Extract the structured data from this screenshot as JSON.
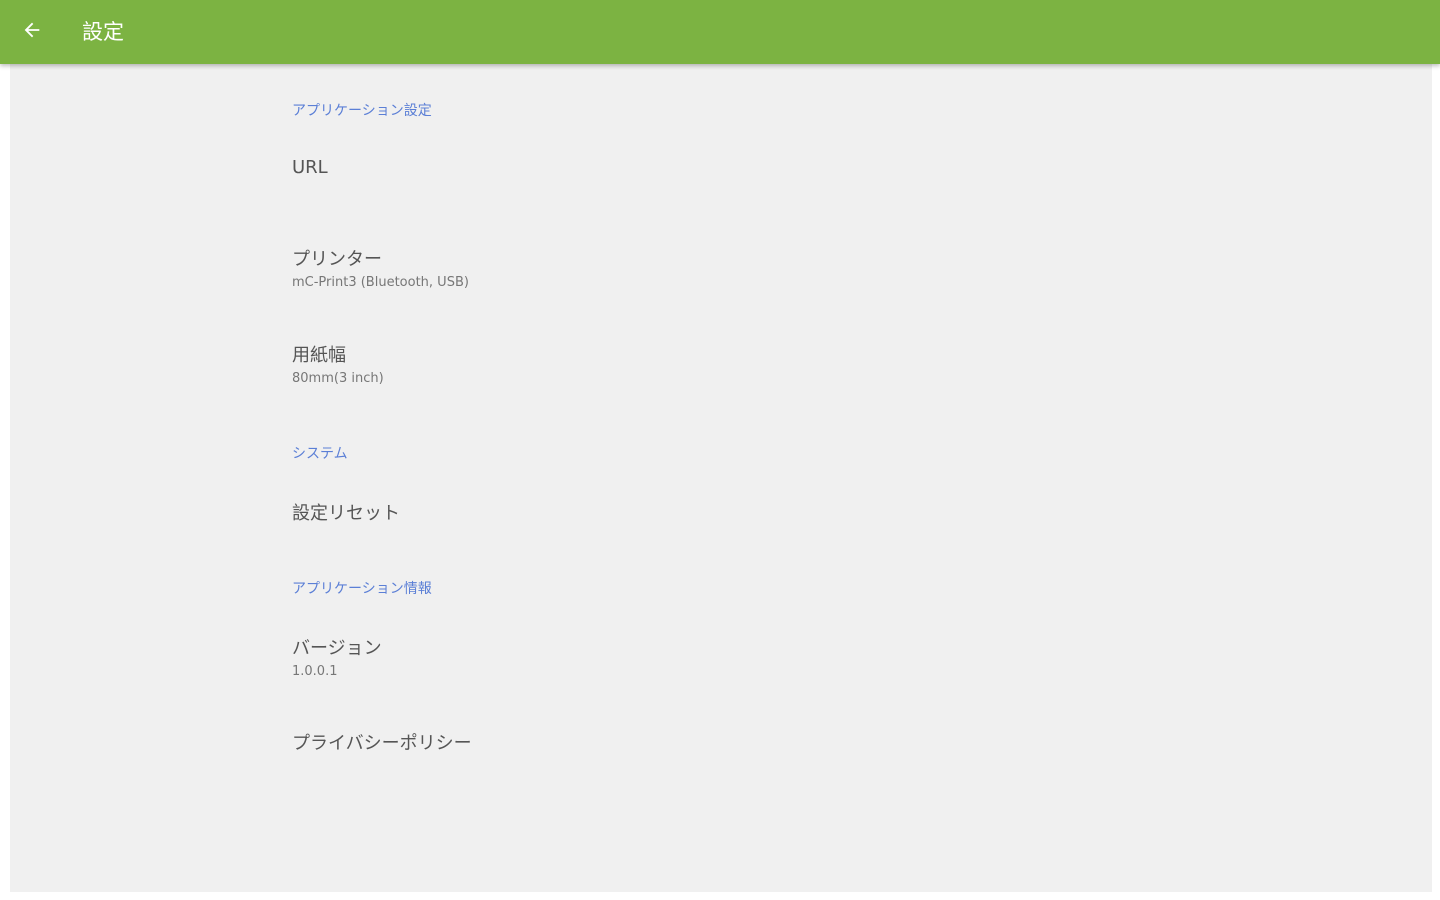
{
  "appbar": {
    "title": "設定",
    "color": "#7cb342"
  },
  "icons": {
    "back": "arrow-left-icon"
  },
  "sections": {
    "app_settings": {
      "header": "アプリケーション設定",
      "url": {
        "title": "URL"
      },
      "printer": {
        "title": "プリンター",
        "summary": "mC-Print3 (Bluetooth, USB)"
      },
      "paper_width": {
        "title": "用紙幅",
        "summary": "80mm(3 inch)"
      }
    },
    "system": {
      "header": "システム",
      "reset": {
        "title": "設定リセット"
      }
    },
    "app_info": {
      "header": "アプリケーション情報",
      "version": {
        "title": "バージョン",
        "summary": "1.0.0.1"
      },
      "privacy": {
        "title": "プライバシーポリシー"
      }
    }
  },
  "colors": {
    "section_header": "#5b7fd6",
    "background": "#f0f0f0"
  }
}
